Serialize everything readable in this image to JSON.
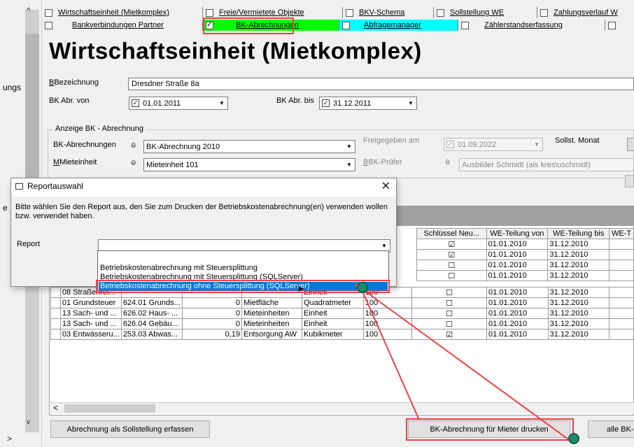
{
  "side": {
    "partial_label": "ungs",
    "partial_label2": "e",
    "scroll_up": "^",
    "scroll_down": "v",
    "bottom_arrow": ">"
  },
  "tabs_row1": [
    {
      "label": "Wirtschaftseinheit (Mietkomplex)",
      "checked": false
    },
    {
      "label": "Freie/Vermietete Objekte",
      "checked": false
    },
    {
      "label": "BKV-Schema",
      "checked": false
    },
    {
      "label": "Sollstellung WE",
      "checked": false
    },
    {
      "label": "Zahlungsverlauf W",
      "checked": false
    }
  ],
  "tabs_row2": [
    {
      "label": "Bankverbindungen Partner",
      "checked": false
    },
    {
      "label": "BK-Abrechnungen",
      "checked": true
    },
    {
      "label": "Abfragemanager",
      "checked": false
    },
    {
      "label": "Zählerstandserfassung",
      "checked": false
    }
  ],
  "colors": {
    "active_tab": "#00ff00",
    "abfrage_tab": "#00ffff",
    "highlight": "#e8414b",
    "selection": "#0078d7"
  },
  "page_title": "Wirtschaftseinheit (Mietkomplex)",
  "form": {
    "bezeichnung_label": "Bezeichnung",
    "bezeichnung_value": "Dresdner Straße 8a",
    "bk_von_label": "BK Abr. von",
    "bk_von_value": "01.01.2011",
    "bk_bis_label": "BK Abr. bis",
    "bk_bis_value": "31.12.2011",
    "anzeige_group": "Anzeige BK - Abrechnung",
    "bk_abrechnungen_label": "BK-Abrechnungen",
    "bk_abrechnungen_value": "BK-Abrechnung 2010",
    "mieteinheit_label": "Mieteinheit",
    "mieteinheit_value": "Mieteinheit 101",
    "freigegeben_label": "Freigegeben am",
    "freigegeben_value": "01.09.2022",
    "sollst_monat_label": "Sollst. Monat",
    "bk_pruefer_label": "BK-Prüfer",
    "bk_pruefer_value": "Ausbilder Schmidt (als kres\\uschmidt)"
  },
  "dialog": {
    "title": "Reportauswahl",
    "close": "✕",
    "message": "Bitte wählen Sie den Report aus, den Sie zum Drucken der Betriebskostenabrechnung(en) verwenden wollen bzw. verwendet haben.",
    "report_label": "Report",
    "report_value": "",
    "options": [
      "Betriebskostenabrechnung mit Steuersplittung",
      "Betriebskostenabrechnung mit Steuersplittung (SQLServer)",
      "Betriebskostenabrechnung ohne Steuersplittung (SQLServer)"
    ],
    "selected_index": 2
  },
  "grid": {
    "right_headers": [
      "Schlüssel Neu...",
      "WE-Teilung von",
      "WE-Teilung bis",
      "WE-T"
    ],
    "top_rows": [
      {
        "key_new": true,
        "von": "01.01.2010",
        "bis": "31.12.2010"
      },
      {
        "key_new": true,
        "von": "01.01.2010",
        "bis": "31.12.2010"
      },
      {
        "key_new": false,
        "von": "01.01.2010",
        "bis": "31.12.2010"
      },
      {
        "key_new": false,
        "von": "01.01.2010",
        "bis": "31.12.2010"
      }
    ],
    "partial_row": {
      "col1": "08 Straßenrei...",
      "col5": "Einheit",
      "col6": "100",
      "key_new": false,
      "von": "01.01.2010",
      "bis": "31.12.2010"
    },
    "rows": [
      {
        "col1": "01 Grundsteuer",
        "col2": "624.01 Grunds...",
        "col3": "0",
        "col4": "Mietfläche",
        "col5": "Quadratmeter",
        "col6": "100",
        "key_new": false,
        "von": "01.01.2010",
        "bis": "31.12.2010"
      },
      {
        "col1": "13 Sach- und ...",
        "col2": "626.02 Haus- ...",
        "col3": "0",
        "col4": "Mieteinheiten",
        "col5": "Einheit",
        "col6": "100",
        "key_new": false,
        "von": "01.01.2010",
        "bis": "31.12.2010"
      },
      {
        "col1": "13 Sach- und ...",
        "col2": "626.04 Gebäu...",
        "col3": "0",
        "col4": "Mieteinheiten",
        "col5": "Einheit",
        "col6": "100",
        "key_new": false,
        "von": "01.01.2010",
        "bis": "31.12.2010"
      },
      {
        "col1": "03 Entwässeru...",
        "col2": "253.03 Abwas...",
        "col3": "0,19",
        "col4": "Entsorgung AW",
        "col5": "Kubikmeter",
        "col6": "100",
        "key_new": true,
        "von": "01.01.2010",
        "bis": "31.12.2010"
      }
    ],
    "scroll_left": "<"
  },
  "buttons": {
    "sollstellung": "Abrechnung als Sollstellung erfassen",
    "drucken": "BK-Abrechnung für Mieter drucken",
    "alle": "alle BK-"
  }
}
